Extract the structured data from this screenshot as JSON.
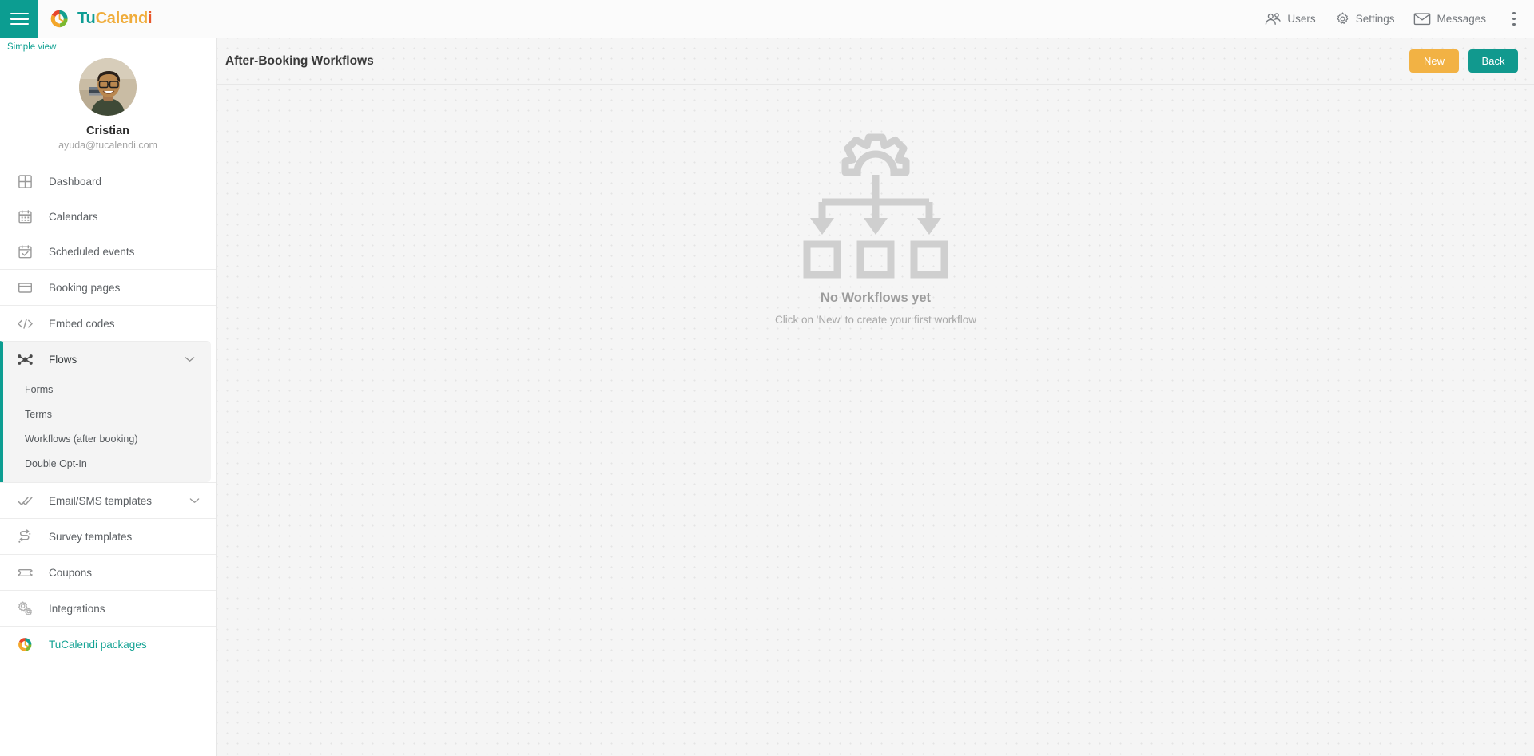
{
  "topbar": {
    "menu_icon": "hamburger-icon",
    "brand": {
      "part1": "Tu",
      "part2": "Calend",
      "part3": "i",
      "logo_icon": "tucalendi-logo-icon"
    },
    "actions": [
      {
        "label": "Users",
        "icon": "users-icon"
      },
      {
        "label": "Settings",
        "icon": "gear-icon"
      },
      {
        "label": "Messages",
        "icon": "envelope-icon"
      }
    ],
    "overflow_icon": "kebab-menu-icon"
  },
  "sidebar": {
    "simple_view_label": "Simple view",
    "profile": {
      "name": "Cristian",
      "email": "ayuda@tucalendi.com",
      "avatar_icon": "user-avatar-photo"
    },
    "groups": [
      {
        "items": [
          {
            "label": "Dashboard",
            "icon": "dashboard-grid-icon"
          },
          {
            "label": "Calendars",
            "icon": "calendar-icon"
          },
          {
            "label": "Scheduled events",
            "icon": "calendar-check-icon"
          }
        ]
      },
      {
        "items": [
          {
            "label": "Booking pages",
            "icon": "window-icon"
          }
        ]
      },
      {
        "items": [
          {
            "label": "Embed codes",
            "icon": "code-brackets-icon"
          }
        ]
      },
      {
        "expanded": true,
        "items": [
          {
            "label": "Flows",
            "icon": "flows-node-icon",
            "chevron": "chevron-down-icon"
          }
        ],
        "subitems": [
          {
            "label": "Forms"
          },
          {
            "label": "Terms"
          },
          {
            "label": "Workflows (after booking)"
          },
          {
            "label": "Double Opt-In"
          }
        ]
      },
      {
        "items": [
          {
            "label": "Email/SMS templates",
            "icon": "double-check-icon",
            "chevron": "chevron-down-icon"
          }
        ]
      },
      {
        "items": [
          {
            "label": "Survey templates",
            "icon": "survey-arrows-icon"
          }
        ]
      },
      {
        "items": [
          {
            "label": "Coupons",
            "icon": "ticket-icon"
          }
        ]
      },
      {
        "items": [
          {
            "label": "Integrations",
            "icon": "gears-icon"
          }
        ]
      },
      {
        "items": [
          {
            "label": "TuCalendi packages",
            "icon": "tucalendi-logo-icon",
            "accent": true
          }
        ]
      }
    ]
  },
  "main": {
    "page_title": "After-Booking Workflows",
    "buttons": {
      "new_label": "New",
      "back_label": "Back"
    },
    "empty_state": {
      "illustration_icon": "workflow-diagram-icon",
      "title": "No Workflows yet",
      "subtitle": "Click on 'New' to create your first workflow"
    }
  },
  "colors": {
    "teal": "#0c9d91",
    "amber": "#f2b244",
    "accent_text": "#12a293",
    "canvas": "#f5f5f5"
  }
}
